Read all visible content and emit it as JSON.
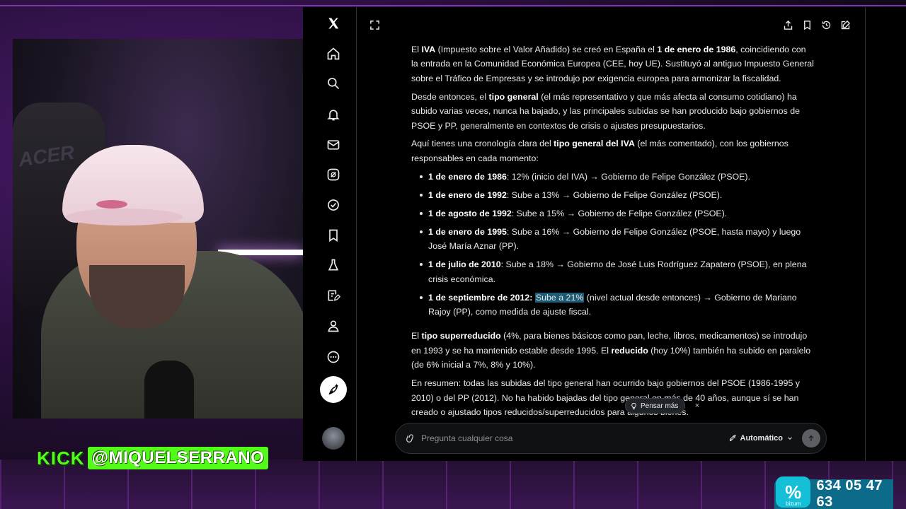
{
  "stream": {
    "kick_word": "KICK",
    "handle": "@MIQUELSERRANO",
    "webcam_chair_text": "ACER",
    "bizum_brand": "bizum",
    "bizum_phone": "634 05 47 63"
  },
  "sidebar": {
    "items": [
      {
        "name": "x-logo-icon"
      },
      {
        "name": "home-icon"
      },
      {
        "name": "search-icon"
      },
      {
        "name": "bell-icon"
      },
      {
        "name": "mail-icon"
      },
      {
        "name": "grok-icon"
      },
      {
        "name": "verified-icon"
      },
      {
        "name": "bookmark-icon"
      },
      {
        "name": "flask-icon"
      },
      {
        "name": "edit-list-icon"
      },
      {
        "name": "person-icon"
      },
      {
        "name": "more-icon"
      }
    ]
  },
  "article": {
    "p1": {
      "a": "El ",
      "b1": "IVA",
      "c": " (Impuesto sobre el Valor Añadido) se creó en España el ",
      "b2": "1 de enero de 1986",
      "d": ", coincidiendo con la entrada en la Comunidad Económica Europea (CEE, hoy UE). Sustituyó al antiguo Impuesto General sobre el Tráfico de Empresas y se introdujo por exigencia europea para armonizar la fiscalidad."
    },
    "p2": {
      "a": "Desde entonces, el ",
      "b1": "tipo general",
      "c": " (el más representativo y que más afecta al consumo cotidiano) ha subido varias veces, nunca ha bajado, y las principales subidas se han producido bajo gobiernos de PSOE y PP, generalmente en contextos de crisis o ajustes presupuestarios."
    },
    "p3": {
      "a": "Aquí tienes una cronología clara del ",
      "b1": "tipo general del IVA",
      "c": " (el más comentado), con los gobiernos responsables en cada momento:"
    },
    "timeline": [
      {
        "date": "1 de enero de 1986",
        "text": ": 12% (inicio del IVA) → Gobierno de Felipe González (PSOE)."
      },
      {
        "date": "1 de enero de 1992",
        "text": ": Sube a 13% → Gobierno de Felipe González (PSOE)."
      },
      {
        "date": "1 de agosto de 1992",
        "text": ": Sube a 15% → Gobierno de Felipe González (PSOE)."
      },
      {
        "date": "1 de enero de 1995",
        "text": ": Sube a 16% → Gobierno de Felipe González (PSOE, hasta mayo) y luego José María Aznar (PP)."
      },
      {
        "date": "1 de julio de 2010",
        "text": ": Sube a 18% → Gobierno de José Luis Rodríguez Zapatero (PSOE), en plena crisis económica."
      }
    ],
    "timeline_last": {
      "date": "1 de septiembre de 2012",
      "sep": ": ",
      "highlight": "Sube a 21%",
      "text": " (nivel actual desde entonces) → Gobierno de Mariano Rajoy (PP), como medida de ajuste fiscal."
    },
    "p4": {
      "a": "El ",
      "b1": "tipo superreducido",
      "c": " (4%, para bienes básicos como pan, leche, libros, medicamentos) se introdujo en 1993 y se ha mantenido estable desde 1995. El ",
      "b2": "reducido",
      "d": " (hoy 10%) también ha subido en paralelo (de 6% inicial a 7%, 8% y 10%)."
    },
    "p5": {
      "a": "En resumen: todas las subidas del tipo general han ocurrido bajo gobiernos del PSOE (1986-1995 y 2010) o del PP (2012). No ha habido bajadas del tipo general en más de 40 años, aunque sí se han creado o ajustado tipos reducidos/superreducidos para algunos bienes."
    }
  },
  "think_chip": {
    "label": "Pensar más",
    "close": "×"
  },
  "composer": {
    "placeholder": "Pregunta cualquier cosa",
    "mode_label": "Automático"
  }
}
